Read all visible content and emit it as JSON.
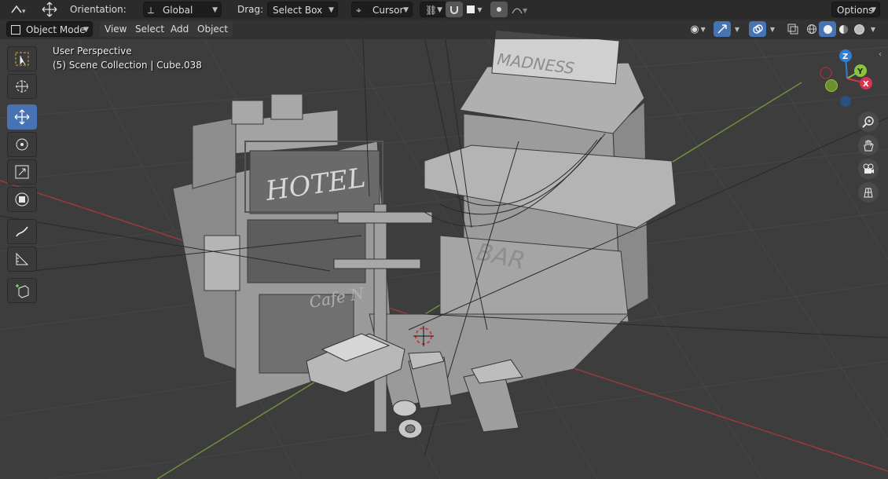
{
  "header": {
    "orientation_label": "Orientation:",
    "orientation_value": "Global",
    "drag_label": "Drag:",
    "drag_value": "Select Box",
    "pivot_value": "Cursor",
    "options_label": "Options"
  },
  "viewport_header": {
    "mode": "Object Mode",
    "menus": [
      "View",
      "Select",
      "Add",
      "Object"
    ]
  },
  "overlay": {
    "perspective": "User Perspective",
    "collection_info": "(5) Scene Collection | Cube.038"
  },
  "scene": {
    "signs": {
      "hotel": "HOTEL",
      "madness": "MADNESS",
      "bar": "BAR",
      "cafe": "Cafe N"
    }
  },
  "gizmo": {
    "x": "X",
    "y": "Y",
    "z": "Z"
  },
  "colors": {
    "accent_blue": "#4772b3",
    "axis_x": "#d9344f",
    "axis_y": "#8bc53f",
    "axis_z": "#2d7fd6",
    "header_bg": "#2b2b2b",
    "viewport_bg": "#3d3d3d"
  },
  "icons": {
    "tools": [
      "select-box-icon",
      "cursor-icon",
      "move-icon",
      "rotate-icon",
      "scale-icon",
      "transform-icon",
      "annotate-icon",
      "measure-icon",
      "add-cube-icon"
    ],
    "nav": [
      "zoom-icon",
      "hand-icon",
      "camera-icon",
      "grid-icon"
    ]
  }
}
